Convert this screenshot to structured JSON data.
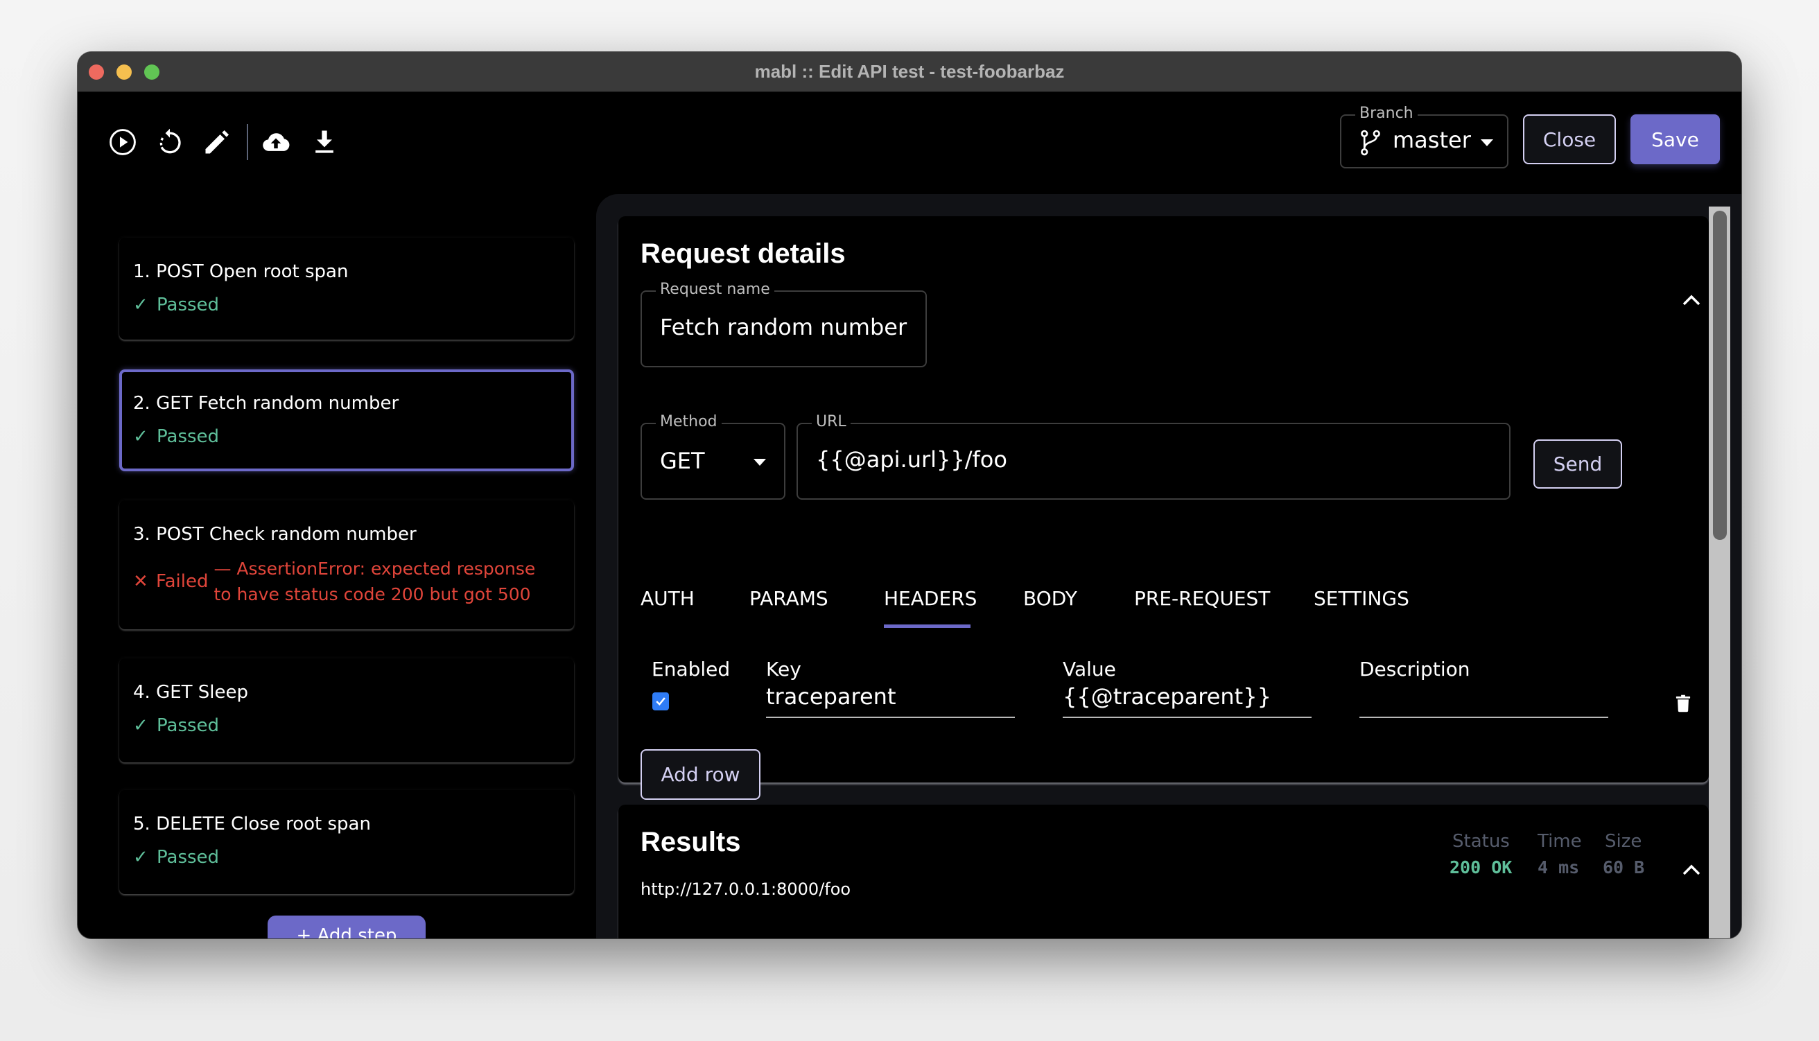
{
  "window": {
    "title": "mabl ::  Edit API test - test-foobarbaz"
  },
  "toolbar": {
    "icons": [
      "play-circle-icon",
      "restart-icon",
      "pencil-icon",
      "cloud-upload-icon",
      "download-icon"
    ],
    "branch": {
      "label": "Branch",
      "value": "master",
      "icon": "git-branch-icon"
    },
    "close_label": "Close",
    "save_label": "Save"
  },
  "steps": [
    {
      "title": "1. POST Open root span",
      "status": "Passed",
      "status_icon": "✓",
      "state": "passed"
    },
    {
      "title": "2. GET Fetch random number",
      "status": "Passed",
      "status_icon": "✓",
      "state": "passed",
      "selected": true
    },
    {
      "title": "3. POST Check random number",
      "status": "Failed",
      "status_icon": "✕",
      "state": "failed",
      "error": "— AssertionError: expected response to have status code 200 but got 500"
    },
    {
      "title": "4. GET Sleep",
      "status": "Passed",
      "status_icon": "✓",
      "state": "passed"
    },
    {
      "title": "5. DELETE Close root span",
      "status": "Passed",
      "status_icon": "✓",
      "state": "passed"
    }
  ],
  "add_step_label": "+ Add step",
  "request": {
    "title": "Request details",
    "name_label": "Request name",
    "name_value": "Fetch random number",
    "method_label": "Method",
    "method_value": "GET",
    "url_label": "URL",
    "url_value": "{{@api.url}}/foo",
    "send_label": "Send",
    "tabs": [
      "AUTH",
      "PARAMS",
      "HEADERS",
      "BODY",
      "PRE-REQUEST",
      "SETTINGS"
    ],
    "active_tab": "HEADERS",
    "headers_table": {
      "columns": [
        "Enabled",
        "Key",
        "Value",
        "Description"
      ],
      "rows": [
        {
          "enabled": true,
          "key": "traceparent",
          "value": "{{@traceparent}}",
          "description": ""
        }
      ]
    },
    "add_row_label": "Add row"
  },
  "results": {
    "title": "Results",
    "url": "http://127.0.0.1:8000/foo",
    "status_label": "Status",
    "status_value": "200 OK",
    "time_label": "Time",
    "time_value": "4 ms",
    "size_label": "Size",
    "size_value": "60 B"
  },
  "colors": {
    "accent": "#6c69c8",
    "passed": "#5fbf9a",
    "failed": "#e0453a",
    "status_ok": "#5fbf9a",
    "muted": "#565c6c"
  }
}
